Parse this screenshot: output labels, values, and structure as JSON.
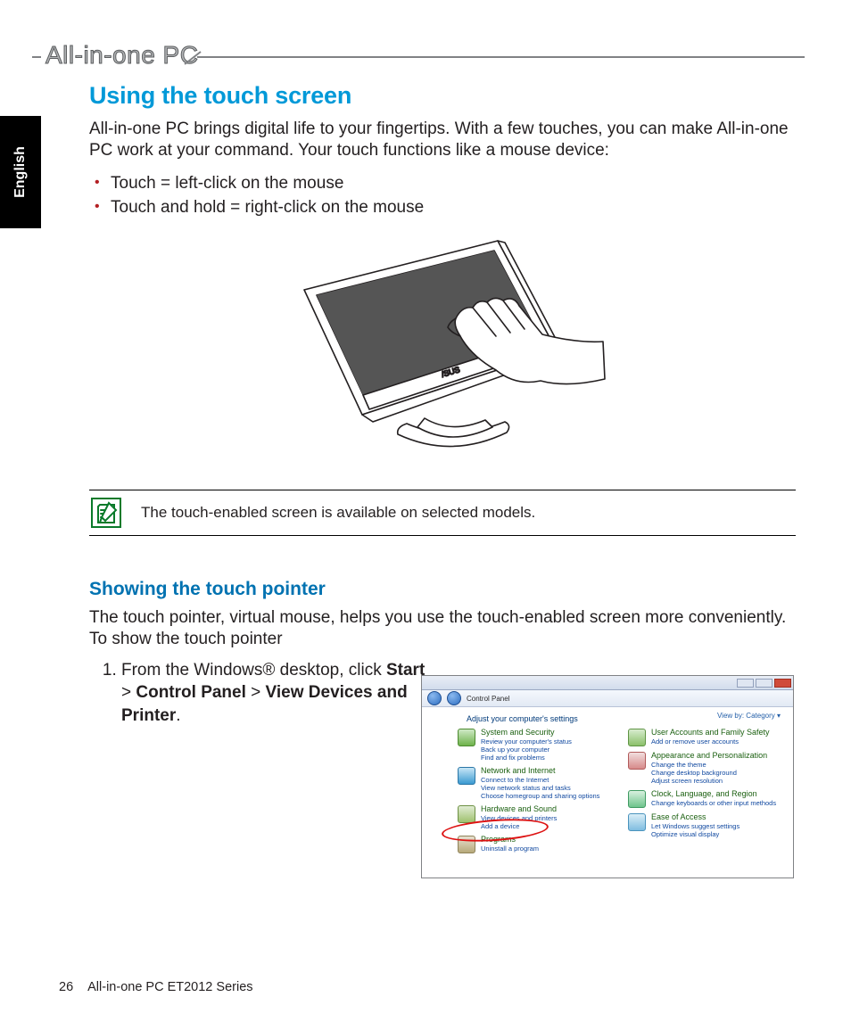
{
  "header": {
    "product_line": "All-in-one PC"
  },
  "language_tab": "English",
  "section_title": "Using the touch screen",
  "intro": "All-in-one PC brings digital life to your fingertips. With a few touches, you can make All-in-one PC work at your command. Your touch functions like a mouse device:",
  "bullets": [
    "Touch = left-click on the mouse",
    "Touch and hold = right-click on the mouse"
  ],
  "note_text": "The touch-enabled screen is available on selected models.",
  "subheading": "Showing the touch pointer",
  "sub_intro": "The touch pointer, virtual mouse, helps you use the touch-enabled screen more conveniently. To show the touch pointer",
  "step1": {
    "prefix": "From the Windows® desktop, click ",
    "b1": "Start",
    "sep1": " > ",
    "b2": "Control Panel",
    "sep2": " > ",
    "b3": "View Devices and Printer",
    "suffix": "."
  },
  "control_panel": {
    "address": "Control Panel",
    "heading": "Adjust your computer's settings",
    "viewby": "View by:  Category ▾",
    "left": [
      {
        "cat": "System and Security",
        "links": [
          "Review your computer's status",
          "Back up your computer",
          "Find and fix problems"
        ]
      },
      {
        "cat": "Network and Internet",
        "links": [
          "Connect to the Internet",
          "View network status and tasks",
          "Choose homegroup and sharing options"
        ]
      },
      {
        "cat": "Hardware and Sound",
        "links": [
          "View devices and printers",
          "Add a device"
        ]
      },
      {
        "cat": "Programs",
        "links": [
          "Uninstall a program"
        ]
      }
    ],
    "right": [
      {
        "cat": "User Accounts and Family Safety",
        "links": [
          "Add or remove user accounts"
        ]
      },
      {
        "cat": "Appearance and Personalization",
        "links": [
          "Change the theme",
          "Change desktop background",
          "Adjust screen resolution"
        ]
      },
      {
        "cat": "Clock, Language, and Region",
        "links": [
          "Change keyboards or other input methods"
        ]
      },
      {
        "cat": "Ease of Access",
        "links": [
          "Let Windows suggest settings",
          "Optimize visual display"
        ]
      }
    ]
  },
  "footer": {
    "page_number": "26",
    "doc_title": "All-in-one PC ET2012 Series"
  }
}
